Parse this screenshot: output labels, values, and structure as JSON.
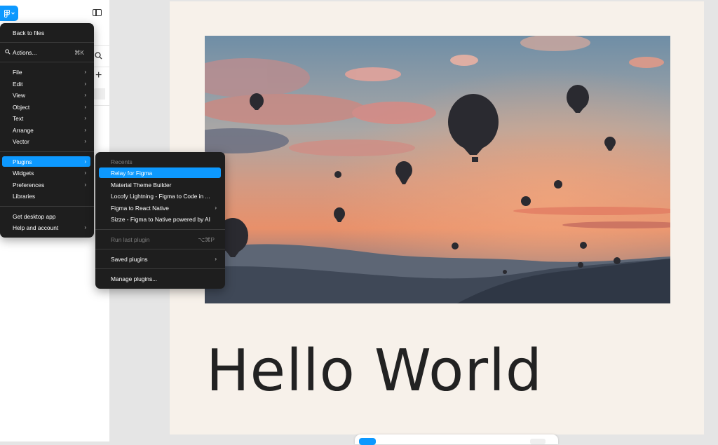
{
  "main_menu": {
    "items": [
      {
        "label": "Back to files"
      },
      {
        "label": "Actions...",
        "shortcut": "⌘K"
      },
      {
        "label": "File"
      },
      {
        "label": "Edit"
      },
      {
        "label": "View"
      },
      {
        "label": "Object"
      },
      {
        "label": "Text"
      },
      {
        "label": "Arrange"
      },
      {
        "label": "Vector"
      },
      {
        "label": "Plugins"
      },
      {
        "label": "Widgets"
      },
      {
        "label": "Preferences"
      },
      {
        "label": "Libraries"
      },
      {
        "label": "Get desktop app"
      },
      {
        "label": "Help and account"
      }
    ],
    "arrow": "›"
  },
  "plugins_menu": {
    "recents_heading": "Recents",
    "items": [
      {
        "label": "Relay for Figma"
      },
      {
        "label": "Material Theme Builder"
      },
      {
        "label": "Locofy Lightning - Figma to Code in ..."
      },
      {
        "label": "Figma to React Native"
      },
      {
        "label": "Sizze - Figma to Native powered by AI"
      },
      {
        "label": "Run last plugin",
        "shortcut": "⌥⌘P"
      },
      {
        "label": "Saved plugins"
      },
      {
        "label": "Manage plugins..."
      }
    ]
  },
  "sidebar": {
    "plus": "+"
  },
  "canvas": {
    "headline": "Hello World"
  },
  "colors": {
    "accent": "#0d99ff",
    "menu_bg": "#1e1e1e",
    "frame_bg": "#f7f1ea",
    "canvas_bg": "#e5e5e5"
  },
  "icons": [
    "figma-logo-icon",
    "chevron-down-icon",
    "panel-toggle-icon",
    "search-icon",
    "plus-icon",
    "chevron-right-icon"
  ]
}
